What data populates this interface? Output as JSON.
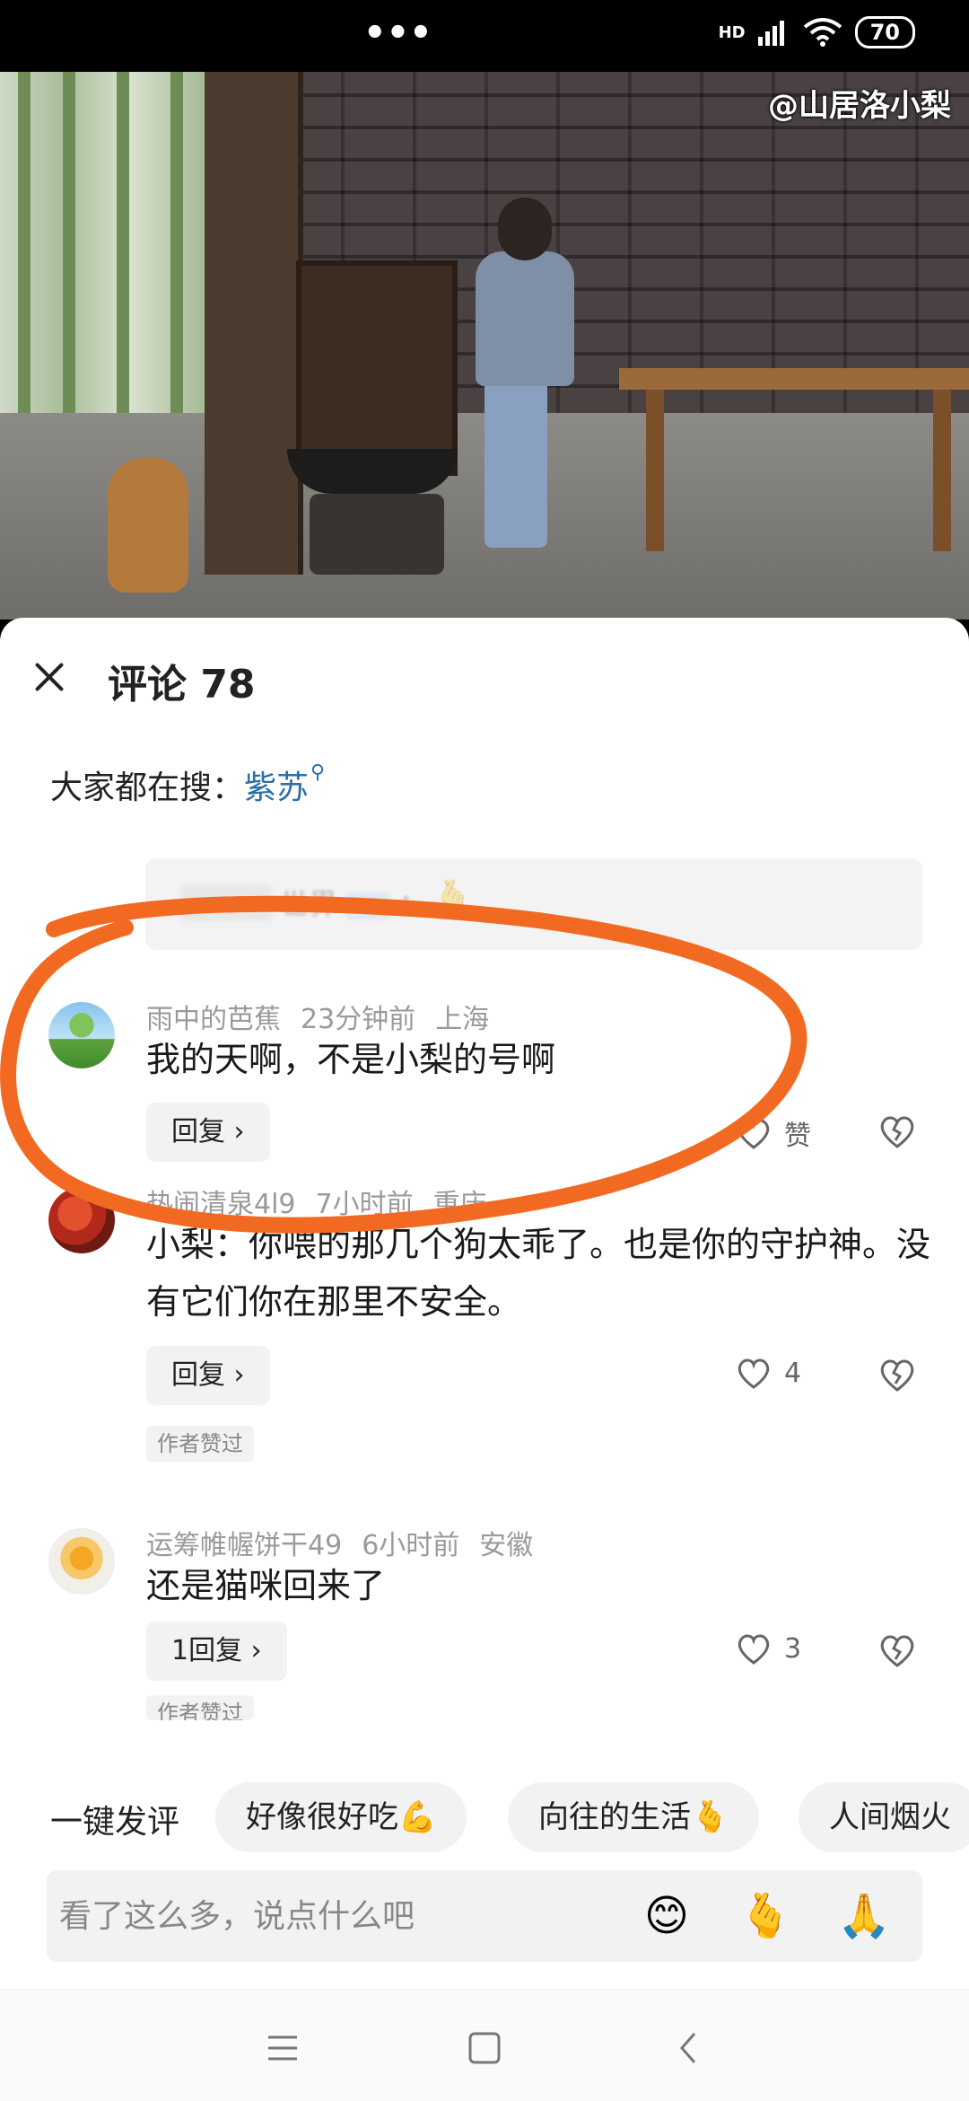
{
  "status_bar": {
    "left_text": "",
    "more_dots": "•••",
    "network": "HD",
    "battery": "70"
  },
  "video": {
    "watermark": "@山居洛小梨"
  },
  "sheet": {
    "title": "评论 78",
    "search_prefix": "大家都在搜：",
    "search_term": "紫苏"
  },
  "reply_preview": {
    "text": "世界",
    "author_tag": "作者",
    "colon": "："
  },
  "comments": [
    {
      "username": "雨中的芭蕉",
      "time": "23分钟前",
      "location": "上海",
      "text": "我的天啊，不是小梨的号啊",
      "reply_label": "回复 ›",
      "like_label": "赞"
    },
    {
      "username": "热闹清泉4l9",
      "time": "7小时前",
      "location": "重庆",
      "text": "小梨：你喂的那几个狗太乖了。也是你的守护神。没有它们你在那里不安全。",
      "reply_label": "回复 ›",
      "like_label": "4",
      "author_liked": "作者赞过"
    },
    {
      "username": "运筹帷幄饼干49",
      "time": "6小时前",
      "location": "安徽",
      "text": "还是猫咪回来了",
      "reply_label": "1回复 ›",
      "like_label": "3",
      "author_liked": "作者赞过"
    }
  ],
  "quick_comment": {
    "label": "一键发评",
    "chips": [
      "好像很好吃💪",
      "向往的生活🫰",
      "人间烟火"
    ]
  },
  "input": {
    "placeholder": "看了这么多，说点什么吧",
    "emojis": [
      "😊",
      "🫰",
      "🙏"
    ]
  },
  "icons": {
    "close": "close-icon",
    "search": "search-icon",
    "heart": "heart-icon",
    "dislike": "broken-heart-icon",
    "menu": "menu-icon",
    "home": "home-icon",
    "back": "back-icon"
  },
  "colors": {
    "accent_link": "#2d6fa6",
    "annotation": "#f26a21"
  }
}
